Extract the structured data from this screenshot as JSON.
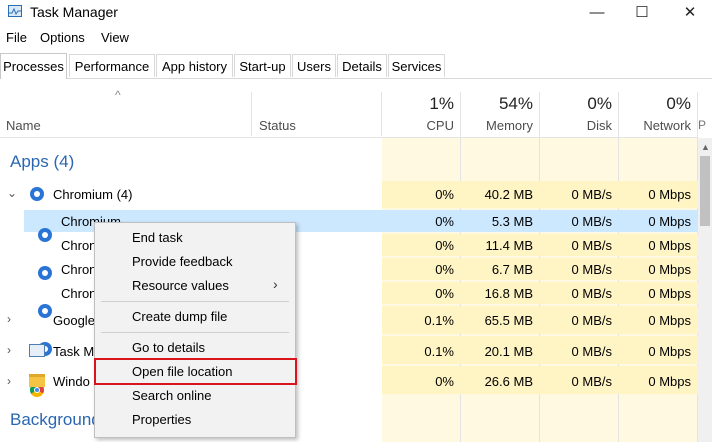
{
  "window": {
    "title": "Task Manager",
    "controls": [
      "—",
      "☐",
      "✕"
    ]
  },
  "menu": [
    "File",
    "Options",
    "View"
  ],
  "tabs": [
    "Processes",
    "Performance",
    "App history",
    "Start-up",
    "Users",
    "Details",
    "Services"
  ],
  "header": {
    "name": "Name",
    "status": "Status",
    "cpu": {
      "pct": "1%",
      "label": "CPU"
    },
    "memory": {
      "pct": "54%",
      "label": "Memory"
    },
    "disk": {
      "pct": "0%",
      "label": "Disk"
    },
    "network": {
      "pct": "0%",
      "label": "Network"
    }
  },
  "groups": {
    "apps": "Apps (4)",
    "background": "Background"
  },
  "rows": [
    {
      "name": "Chromium (4)",
      "cpu": "0%",
      "mem": "40.2 MB",
      "disk": "0 MB/s",
      "net": "0 Mbps"
    },
    {
      "name": "Chromium",
      "cpu": "0%",
      "mem": "5.3 MB",
      "disk": "0 MB/s",
      "net": "0 Mbps"
    },
    {
      "name": "Chron",
      "cpu": "0%",
      "mem": "11.4 MB",
      "disk": "0 MB/s",
      "net": "0 Mbps"
    },
    {
      "name": "Chron",
      "cpu": "0%",
      "mem": "6.7 MB",
      "disk": "0 MB/s",
      "net": "0 Mbps"
    },
    {
      "name": "Chron",
      "cpu": "0%",
      "mem": "16.8 MB",
      "disk": "0 MB/s",
      "net": "0 Mbps"
    },
    {
      "name": "Google",
      "cpu": "0.1%",
      "mem": "65.5 MB",
      "disk": "0 MB/s",
      "net": "0 Mbps"
    },
    {
      "name": "Task Ma",
      "cpu": "0.1%",
      "mem": "20.1 MB",
      "disk": "0 MB/s",
      "net": "0 Mbps"
    },
    {
      "name": "Windo",
      "cpu": "0%",
      "mem": "26.6 MB",
      "disk": "0 MB/s",
      "net": "0 Mbps"
    }
  ],
  "context_menu": [
    "End task",
    "Provide feedback",
    "Resource values",
    "Create dump file",
    "Go to details",
    "Open file location",
    "Search online",
    "Properties"
  ],
  "colors": {
    "highlight_box": "#d9141b",
    "selected_row": "#cce8ff",
    "heat_yellow": "#fff4c4"
  }
}
